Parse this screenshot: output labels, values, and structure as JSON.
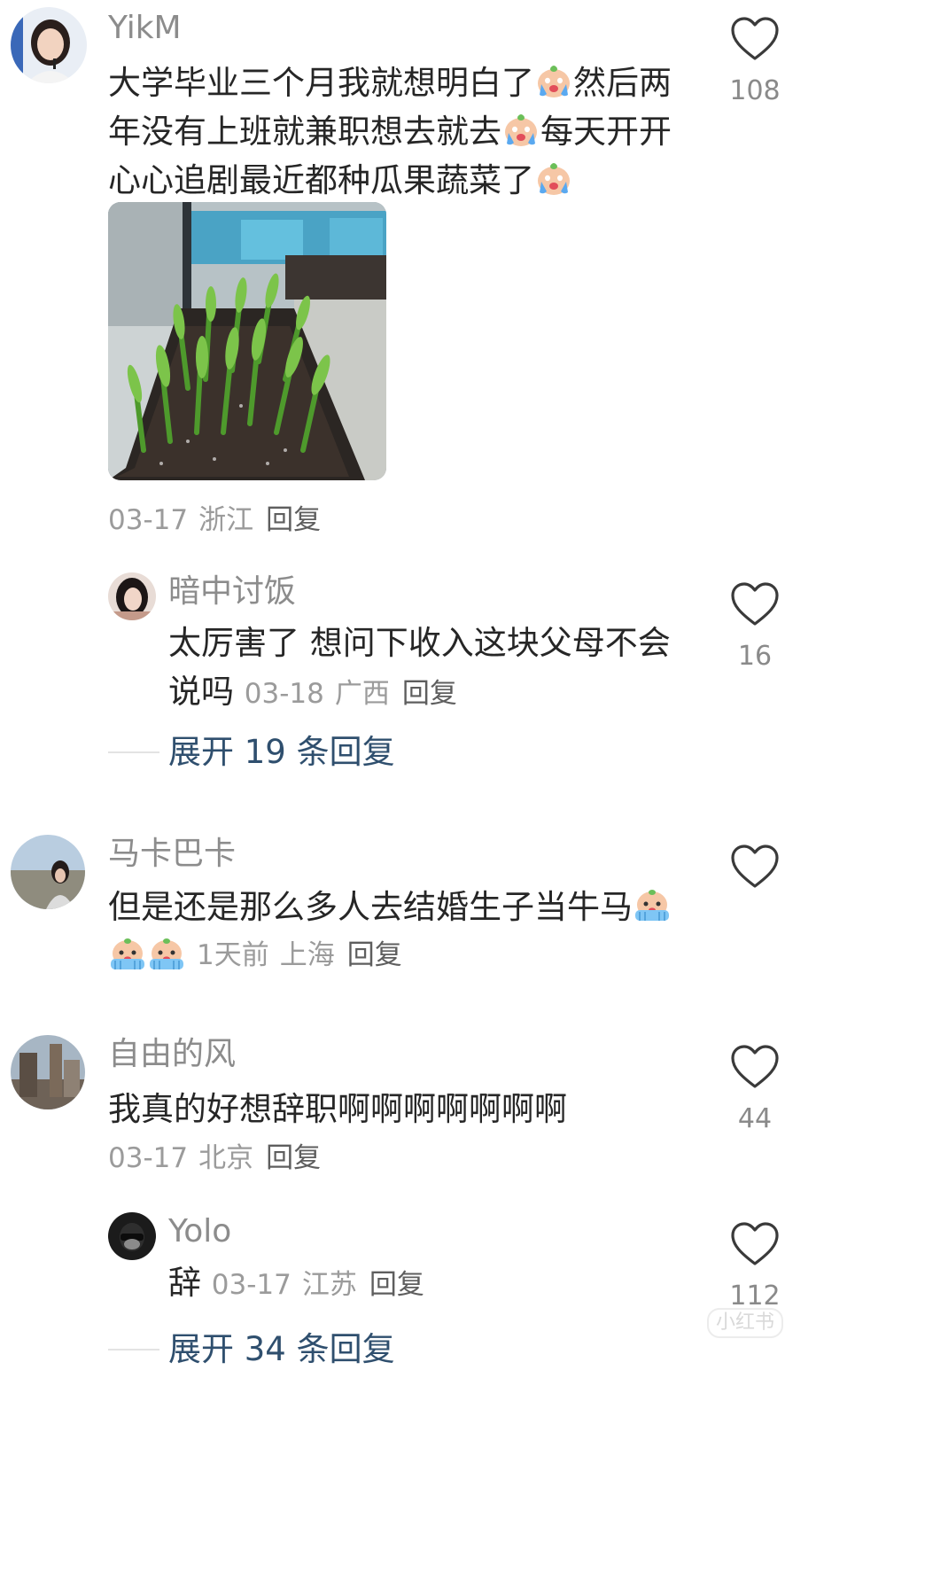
{
  "comments": [
    {
      "username": "YikM",
      "text_lines": [
        "大学毕业三个月我就想明白了",
        "然后两",
        "年没有上班就兼职想去就去",
        "每天开开",
        "心心追剧最近都种瓜果蔬菜了"
      ],
      "date": "03-17",
      "location": "浙江",
      "reply_label": "回复",
      "likes": "108",
      "has_image": true
    },
    {
      "username": "暗中讨饭",
      "text_lines": [
        "太厉害了 想问下收入这块父母不会",
        "说吗"
      ],
      "date": "03-18",
      "location": "广西",
      "reply_label": "回复",
      "likes": "16",
      "expand_label": "展开 19 条回复"
    },
    {
      "username": "马卡巴卡",
      "text_lines": [
        "但是还是那么多人去结婚生子当牛马"
      ],
      "date": "1天前",
      "location": "上海",
      "reply_label": "回复",
      "likes": ""
    },
    {
      "username": "自由的风",
      "text_lines": [
        "我真的好想辞职啊啊啊啊啊啊啊"
      ],
      "date": "03-17",
      "location": "北京",
      "reply_label": "回复",
      "likes": "44"
    },
    {
      "username": "Yolo",
      "text_lines": [
        "辞"
      ],
      "date": "03-17",
      "location": "江苏",
      "reply_label": "回复",
      "likes": "112",
      "expand_label": "展开 34 条回复"
    }
  ],
  "watermark": "小红书",
  "icons": {
    "like": "heart-outline-icon",
    "emoji_cry": "crying-emoji-icon",
    "emoji_cover_face": "covering-face-emoji-icon"
  },
  "colors": {
    "username": "#8c8c8c",
    "expand": "#2f4f6e",
    "meta": "#9b9b9b"
  }
}
